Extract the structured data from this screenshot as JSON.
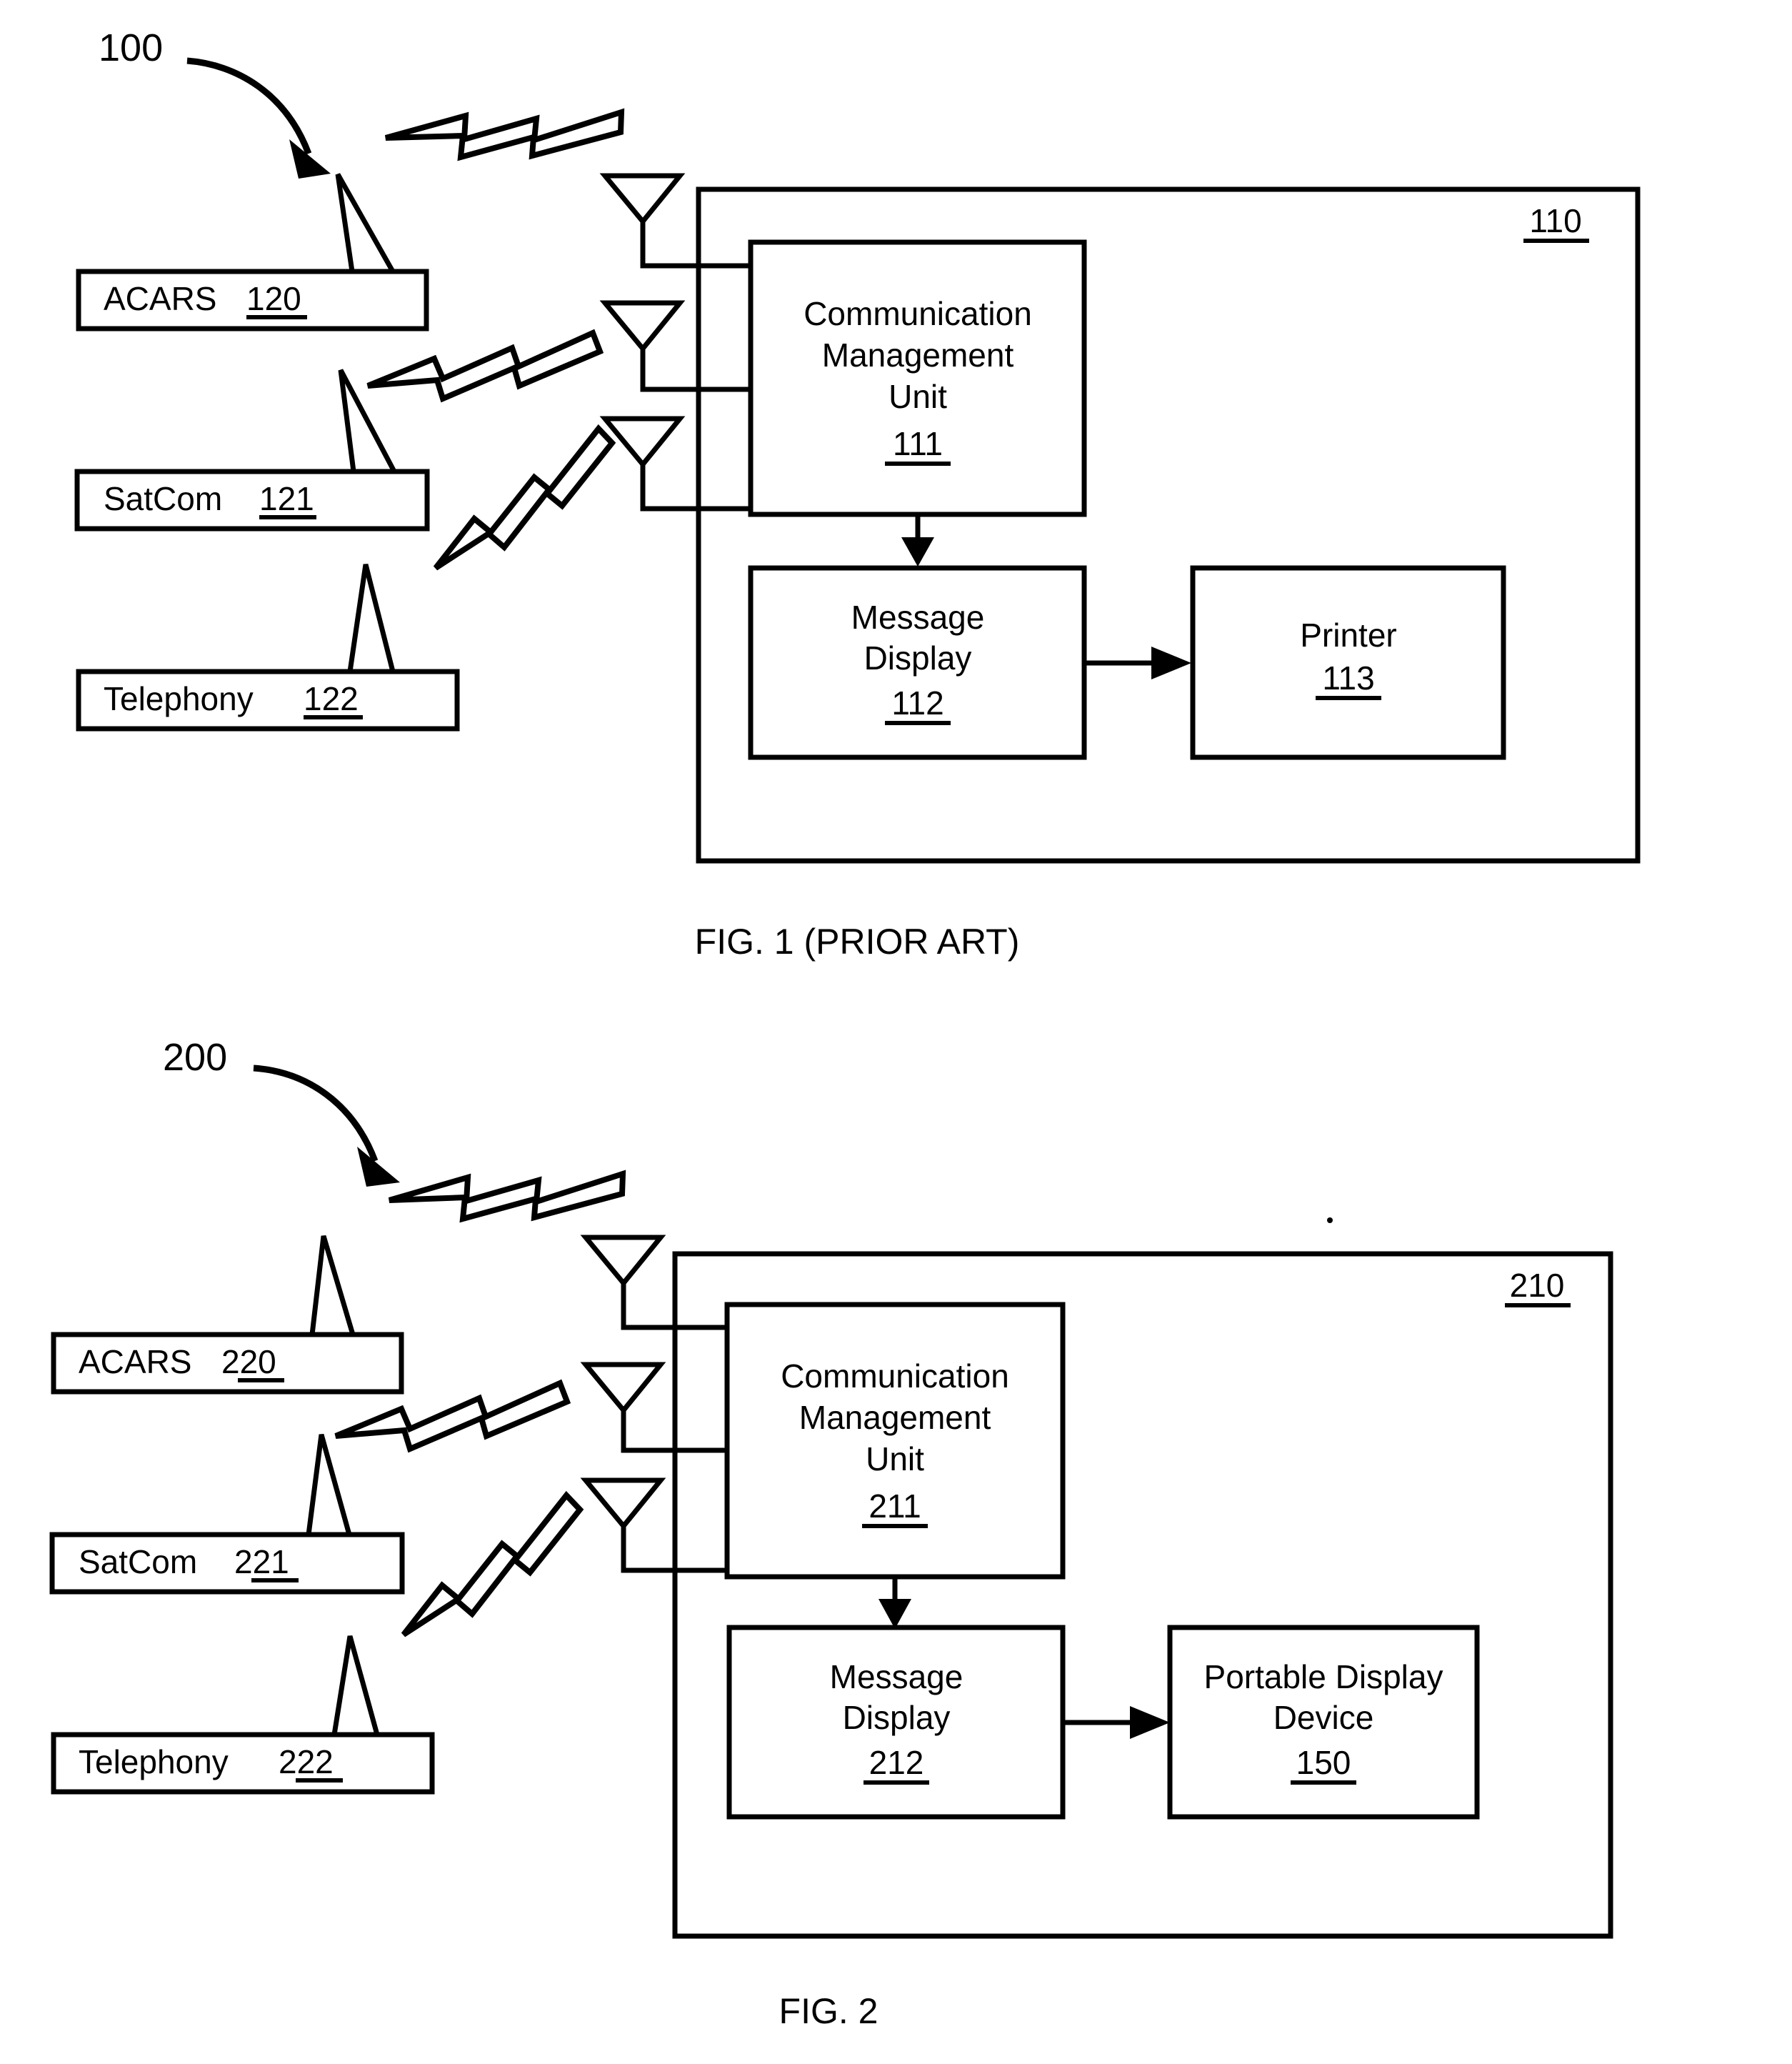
{
  "document": {
    "type": "patent-figure-sheet",
    "background_color": "#ffffff",
    "ink_color": "#000000"
  },
  "figures": [
    {
      "id": "figure-1",
      "caption": "FIG. 1 (PRIOR ART)",
      "lead_label": "100",
      "enclosure_label": "110",
      "ground_stations": [
        {
          "name": "ACARS",
          "ref": "120",
          "label": "ACARS  120"
        },
        {
          "name": "SatCom",
          "ref": "121",
          "label": "SatCom  121"
        },
        {
          "name": "Telephony",
          "ref": "122",
          "label": "Telephony  122"
        }
      ],
      "blocks": [
        {
          "id": "cmu-1",
          "lines": [
            "Communication",
            "Management",
            "Unit"
          ],
          "ref": "111"
        },
        {
          "id": "message-display-1",
          "lines": [
            "Message",
            "Display"
          ],
          "ref": "112"
        },
        {
          "id": "printer-1",
          "lines": [
            "Printer"
          ],
          "ref": "113"
        }
      ],
      "antennas": [
        "aircraft-antenna-acars",
        "aircraft-antenna-satcom",
        "aircraft-antenna-telephony"
      ],
      "rf_links": [
        "lightning-bolt-acars",
        "lightning-bolt-satcom",
        "lightning-bolt-telephony"
      ],
      "flow_arrows": [
        {
          "from": "cmu-1",
          "to": "message-display-1",
          "direction": "down"
        },
        {
          "from": "message-display-1",
          "to": "printer-1",
          "direction": "right"
        }
      ]
    },
    {
      "id": "figure-2",
      "caption": "FIG. 2",
      "lead_label": "200",
      "enclosure_label": "210",
      "ground_stations": [
        {
          "name": "ACARS",
          "ref": "220",
          "label": "ACARS  220"
        },
        {
          "name": "SatCom",
          "ref": "221",
          "label": "SatCom  221"
        },
        {
          "name": "Telephony",
          "ref": "222",
          "label": "Telephony  222"
        }
      ],
      "blocks": [
        {
          "id": "cmu-2",
          "lines": [
            "Communication",
            "Management",
            "Unit"
          ],
          "ref": "211"
        },
        {
          "id": "message-display-2",
          "lines": [
            "Message",
            "Display"
          ],
          "ref": "212"
        },
        {
          "id": "portable-display-device",
          "lines": [
            "Portable Display",
            "Device"
          ],
          "ref": "150"
        }
      ],
      "antennas": [
        "aircraft-antenna-acars",
        "aircraft-antenna-satcom",
        "aircraft-antenna-telephony"
      ],
      "rf_links": [
        "lightning-bolt-acars",
        "lightning-bolt-satcom",
        "lightning-bolt-telephony"
      ],
      "flow_arrows": [
        {
          "from": "cmu-2",
          "to": "message-display-2",
          "direction": "down"
        },
        {
          "from": "message-display-2",
          "to": "portable-display-device",
          "direction": "right"
        }
      ]
    }
  ],
  "fig1": {
    "lead": "100",
    "corner_ref": "110",
    "caption": "FIG. 1 (PRIOR ART)",
    "acars": "ACARS",
    "acars_ref": "120",
    "satcom": "SatCom",
    "satcom_ref": "121",
    "telephony": "Telephony",
    "telephony_ref": "122",
    "cmu_l1": "Communication",
    "cmu_l2": "Management",
    "cmu_l3": "Unit",
    "cmu_ref": "111",
    "md_l1": "Message",
    "md_l2": "Display",
    "md_ref": "112",
    "out_l1": "Printer",
    "out_ref": "113"
  },
  "fig2": {
    "lead": "200",
    "corner_ref": "210",
    "caption": "FIG. 2",
    "acars": "ACARS",
    "acars_ref": "220",
    "satcom": "SatCom",
    "satcom_ref": "221",
    "telephony": "Telephony",
    "telephony_ref": "222",
    "cmu_l1": "Communication",
    "cmu_l2": "Management",
    "cmu_l3": "Unit",
    "cmu_ref": "211",
    "md_l1": "Message",
    "md_l2": "Display",
    "md_ref": "212",
    "out_l1": "Portable Display",
    "out_l2": "Device",
    "out_ref": "150"
  }
}
